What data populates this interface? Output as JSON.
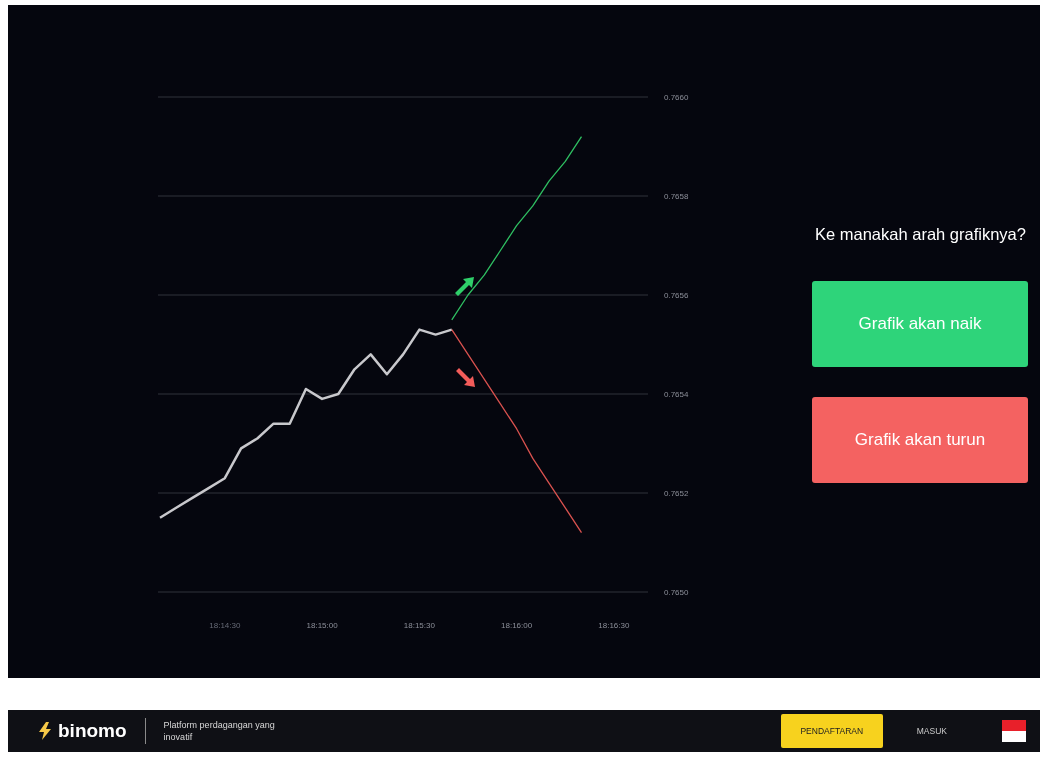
{
  "chart": {
    "chart_data": {
      "type": "line",
      "categories": [
        null,
        null,
        null,
        null,
        "18:14:30",
        null,
        null,
        null,
        null,
        null,
        "18:15:00",
        null,
        null,
        null,
        null,
        null,
        "18:15:30",
        null,
        null,
        null,
        null,
        null,
        "18:16:00",
        null,
        null,
        null,
        null,
        null,
        "18:16:30"
      ],
      "series": [
        {
          "color": "#c8c8cc",
          "values": [
            0.76515,
            0.76517,
            0.76519,
            0.76521,
            0.76523,
            0.76529,
            0.76531,
            0.76534,
            0.76534,
            0.76541,
            0.76539,
            0.7654,
            0.76545,
            0.76548,
            0.76544,
            0.76548,
            0.76553,
            0.76552,
            0.76553,
            null,
            null,
            null,
            null,
            null,
            null,
            null,
            null,
            null,
            null
          ]
        },
        {
          "color": "#2fbf62",
          "values": [
            null,
            null,
            null,
            null,
            null,
            null,
            null,
            null,
            null,
            null,
            null,
            null,
            null,
            null,
            null,
            null,
            null,
            null,
            0.76555,
            0.7656,
            0.76564,
            0.76569,
            0.76574,
            0.76578,
            0.76583,
            0.76587,
            0.76592,
            null,
            null
          ]
        },
        {
          "color": "#d9524f",
          "values": [
            null,
            null,
            null,
            null,
            null,
            null,
            null,
            null,
            null,
            null,
            null,
            null,
            null,
            null,
            null,
            null,
            null,
            null,
            0.76553,
            0.76548,
            0.76543,
            0.76538,
            0.76533,
            0.76527,
            0.76522,
            0.76517,
            0.76512,
            null,
            null
          ]
        }
      ],
      "ylim": [
        0.765,
        0.766
      ],
      "grid": true,
      "yticks": [
        {
          "value": 0.766,
          "label": "0.7660"
        },
        {
          "value": 0.7658,
          "label": "0.7658"
        },
        {
          "value": 0.7656,
          "label": "0.7656"
        },
        {
          "value": 0.7654,
          "label": "0.7654"
        },
        {
          "value": 0.7652,
          "label": "0.7652"
        },
        {
          "value": 0.765,
          "label": "0.7650"
        }
      ]
    }
  },
  "question": "Ke manakah arah grafiknya?",
  "choices": [
    {
      "kind": "up",
      "label": "Grafik akan naik"
    },
    {
      "kind": "down",
      "label": "Grafik akan turun"
    }
  ],
  "footer": {
    "logo": "binomo",
    "tagline": "Platform perdagangan yang inovatif",
    "register": "PENDAFTARAN",
    "login": "MASUK"
  }
}
